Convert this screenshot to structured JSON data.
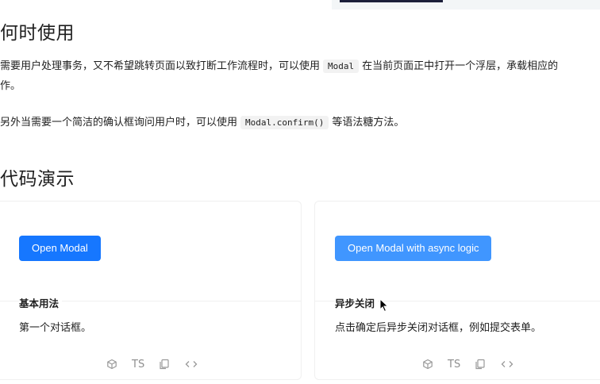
{
  "section_when": {
    "title": "何时使用",
    "p1_before": "需要用户处理事务，又不希望跳转页面以致打断工作流程时，可以使用",
    "p1_code": "Modal",
    "p1_after": "在当前页面正中打开一个浮层，承载相应的",
    "p1_line2": "作。",
    "p2_before": "另外当需要一个简洁的确认框询问用户时，可以使用",
    "p2_code": "Modal.confirm()",
    "p2_after": "等语法糖方法。"
  },
  "section_demo": {
    "title": "代码演示"
  },
  "demos": [
    {
      "button_label": "Open Modal",
      "title": "基本用法",
      "description": "第一个对话框。",
      "ts_label": "TS"
    },
    {
      "button_label": "Open Modal with async logic",
      "title": "异步关闭",
      "description": "点击确定后异步关闭对话框，例如提交表单。",
      "ts_label": "TS"
    }
  ],
  "colors": {
    "primary": "#1677ff",
    "primary_hover": "#4096ff",
    "border": "#f0f0f0"
  },
  "icons": [
    "codesandbox-icon",
    "copy-icon",
    "code-expand-icon",
    "cursor-icon"
  ]
}
